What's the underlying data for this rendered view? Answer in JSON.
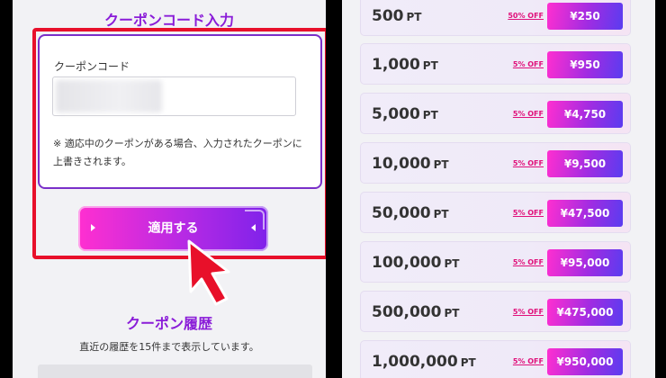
{
  "coupon": {
    "title": "クーポンコード入力",
    "field_label": "クーポンコード",
    "field_value": "",
    "note": "※ 適応中のクーポンがある場合、入力されたクーポンに上書きされます。",
    "apply_label": "適用する"
  },
  "history": {
    "title": "クーポン履歴",
    "note": "直近の履歴を15件まで表示しています。"
  },
  "points": {
    "unit": "PT",
    "rows": [
      {
        "amount": "500",
        "discount": "50% OFF",
        "price": "¥250"
      },
      {
        "amount": "1,000",
        "discount": "5% OFF",
        "price": "¥950"
      },
      {
        "amount": "5,000",
        "discount": "5% OFF",
        "price": "¥4,750"
      },
      {
        "amount": "10,000",
        "discount": "5% OFF",
        "price": "¥9,500"
      },
      {
        "amount": "50,000",
        "discount": "5% OFF",
        "price": "¥47,500"
      },
      {
        "amount": "100,000",
        "discount": "5% OFF",
        "price": "¥95,000"
      },
      {
        "amount": "500,000",
        "discount": "5% OFF",
        "price": "¥475,000"
      },
      {
        "amount": "1,000,000",
        "discount": "5% OFF",
        "price": "¥950,000"
      }
    ]
  },
  "colors": {
    "highlight": "#e8102a",
    "accent_purple": "#8a1cd8",
    "pink": "#ff2fd0",
    "discount_red": "#e0107a"
  },
  "icons": {
    "arrow": "red-cursor-arrow-icon",
    "button_markers": "triangle-marker-icon"
  }
}
